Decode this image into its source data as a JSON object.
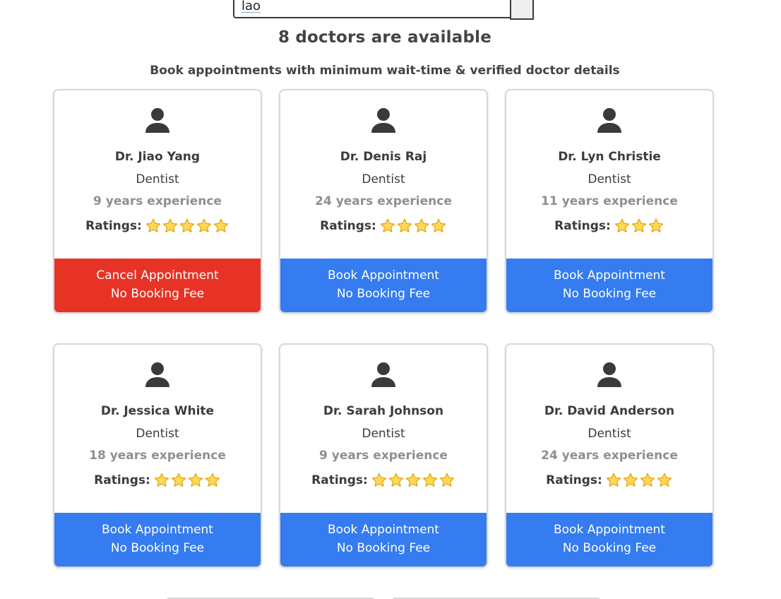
{
  "search": {
    "value": "lao"
  },
  "heading": "8 doctors are available",
  "subheading": "Book appointments with minimum wait-time & verified doctor details",
  "ratings_label": "Ratings:",
  "colors": {
    "book": "#347cf0",
    "cancel": "#e73326",
    "star_fill": "#ffd95a",
    "star_stroke": "#e2a200"
  },
  "doctors": [
    {
      "name": "Dr. Jiao Yang",
      "specialty": "Dentist",
      "experience": "9 years experience",
      "stars": 5,
      "action": {
        "line1": "Cancel Appointment",
        "line2": "No Booking Fee",
        "kind": "cancel"
      }
    },
    {
      "name": "Dr. Denis Raj",
      "specialty": "Dentist",
      "experience": "24 years experience",
      "stars": 4,
      "action": {
        "line1": "Book Appointment",
        "line2": "No Booking Fee",
        "kind": "book"
      }
    },
    {
      "name": "Dr. Lyn Christie",
      "specialty": "Dentist",
      "experience": "11 years experience",
      "stars": 3,
      "action": {
        "line1": "Book Appointment",
        "line2": "No Booking Fee",
        "kind": "book"
      }
    },
    {
      "name": "Dr. Jessica White",
      "specialty": "Dentist",
      "experience": "18 years experience",
      "stars": 4,
      "action": {
        "line1": "Book Appointment",
        "line2": "No Booking Fee",
        "kind": "book"
      }
    },
    {
      "name": "Dr. Sarah Johnson",
      "specialty": "Dentist",
      "experience": "9 years experience",
      "stars": 5,
      "action": {
        "line1": "Book Appointment",
        "line2": "No Booking Fee",
        "kind": "book"
      }
    },
    {
      "name": "Dr. David Anderson",
      "specialty": "Dentist",
      "experience": "24 years experience",
      "stars": 4,
      "action": {
        "line1": "Book Appointment",
        "line2": "No Booking Fee",
        "kind": "book"
      }
    }
  ]
}
